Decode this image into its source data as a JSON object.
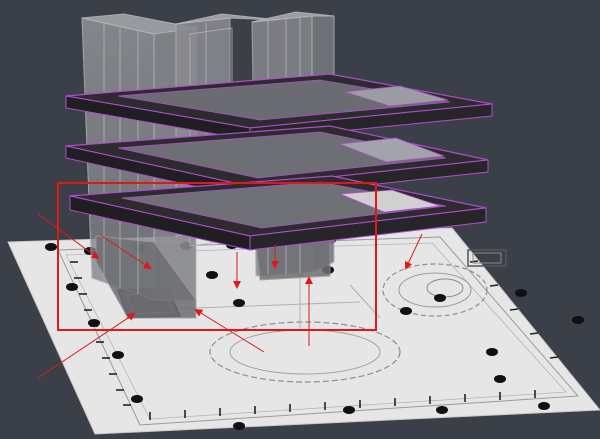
{
  "viewport": {
    "background": "#3b4048",
    "view": "perspective"
  },
  "colors": {
    "ground_plane": "#e6e6e6",
    "slab_fill": "#2c2c2e",
    "slab_edge": "#b24bd1",
    "ghost_volume": "#8f9095",
    "annotation": "#e01818",
    "column_dot": "#111111"
  },
  "scene": {
    "floor_slabs": 3,
    "ghost_volumes": 3,
    "annotation_rectangle": 1,
    "annotation_arrows": 9
  }
}
